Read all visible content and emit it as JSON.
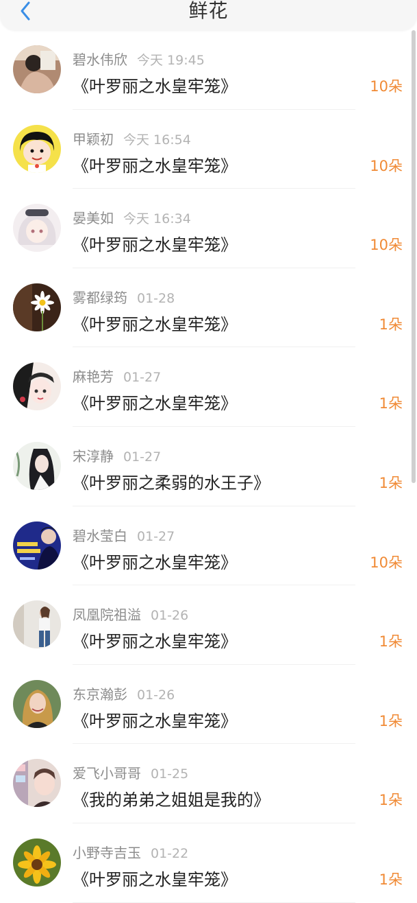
{
  "header": {
    "title": "鲜花",
    "back_icon": "chevron-left-icon"
  },
  "accent_color": "#f08a35",
  "items": [
    {
      "name": "碧水伟欣",
      "time": "今天 19:45",
      "book": "《叶罗丽之水皇牢笼》",
      "count": "10朵"
    },
    {
      "name": "甲颖初",
      "time": "今天 16:54",
      "book": "《叶罗丽之水皇牢笼》",
      "count": "10朵"
    },
    {
      "name": "晏美如",
      "time": "今天 16:34",
      "book": "《叶罗丽之水皇牢笼》",
      "count": "10朵"
    },
    {
      "name": "雾都绿筠",
      "time": "01-28",
      "book": "《叶罗丽之水皇牢笼》",
      "count": "1朵"
    },
    {
      "name": "麻艳芳",
      "time": "01-27",
      "book": "《叶罗丽之水皇牢笼》",
      "count": "1朵"
    },
    {
      "name": "宋淳静",
      "time": "01-27",
      "book": "《叶罗丽之柔弱的水王子》",
      "count": "1朵"
    },
    {
      "name": "碧水莹白",
      "time": "01-27",
      "book": "《叶罗丽之水皇牢笼》",
      "count": "10朵"
    },
    {
      "name": "凤凰院祖溢",
      "time": "01-26",
      "book": "《叶罗丽之水皇牢笼》",
      "count": "1朵"
    },
    {
      "name": "东京瀚彭",
      "time": "01-26",
      "book": "《叶罗丽之水皇牢笼》",
      "count": "1朵"
    },
    {
      "name": "爱飞小哥哥",
      "time": "01-25",
      "book": "《我的弟弟之姐姐是我的》",
      "count": "1朵"
    },
    {
      "name": "小野寺吉玉",
      "time": "01-22",
      "book": "《叶罗丽之水皇牢笼》",
      "count": "1朵"
    }
  ]
}
